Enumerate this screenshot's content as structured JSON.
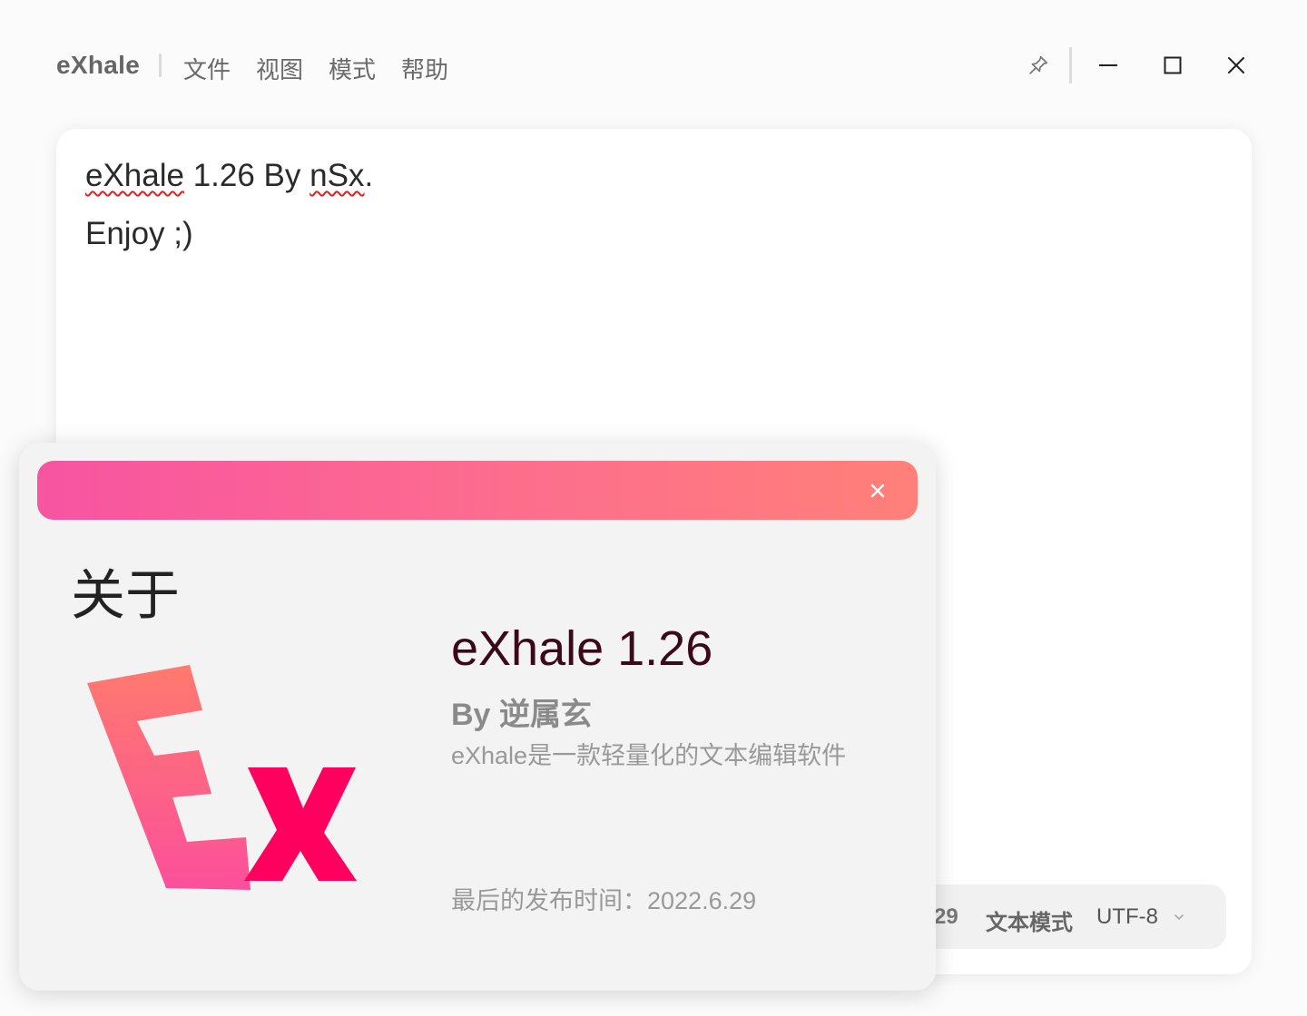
{
  "titlebar": {
    "app_name": "eXhale",
    "menus": {
      "file": "文件",
      "view": "视图",
      "mode": "模式",
      "help": "帮助"
    }
  },
  "editor": {
    "line1_word1": "eXhale",
    "line1_mid": " 1.26 By ",
    "line1_word2": "nSx",
    "line1_end": ".",
    "line2": "Enjoy ;)"
  },
  "statusbar": {
    "lines_fragment": "29",
    "mode": "文本模式",
    "encoding": "UTF-8"
  },
  "about": {
    "title": "关于",
    "version": "eXhale 1.26",
    "author": "By 逆属玄",
    "description": "eXhale是一款轻量化的文本编辑软件",
    "release": "最后的发布时间：2022.6.29",
    "logo_letters": "Ex"
  },
  "colors": {
    "header_gradient_start": "#f754a1",
    "header_gradient_end": "#ff8079",
    "logo_e_top": "#ff7a6e",
    "logo_e_bottom": "#fb4f9b",
    "logo_x": "#ff005e"
  },
  "icons": {
    "pin": "pin-icon",
    "minimize": "minimize-icon",
    "maximize": "maximize-icon",
    "close": "close-icon",
    "dialog_close": "close-icon",
    "encoding_dropdown": "chevron-down-icon"
  }
}
